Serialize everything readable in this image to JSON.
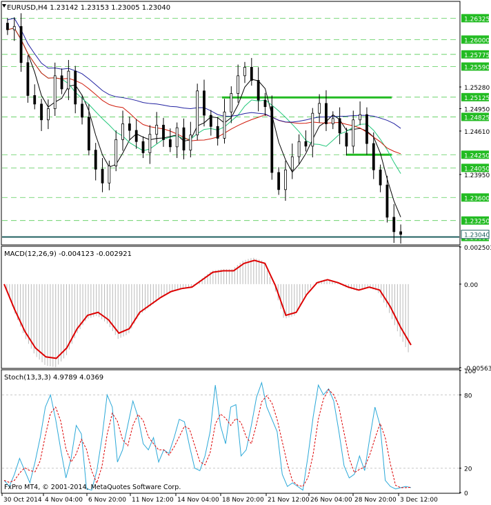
{
  "colors": {
    "background": "#ffffff",
    "frame": "#000000",
    "grid": "#c8c8c8",
    "hline": "#22bb22",
    "hline_dashed": "#55cc55",
    "price_tag_bg": "#1f5f5f",
    "ma_fast": "#000000",
    "ma_mid": "#21c77a",
    "ma_slow_red": "#d01a0a",
    "ma_slow_blue": "#2020a0",
    "macd_signal": "#dd0000",
    "macd_hist": "#b8b8b8",
    "stoch_main": "#2aa8d8",
    "stoch_signal": "#dd0000"
  },
  "main_panel": {
    "header": "EURUSD,H4  1.23142 1.23153 1.23005 1.23040",
    "current_price_label": "1.23040",
    "price_labels": [
      "1.26325",
      "1.26000",
      "1.25775",
      "1.25590",
      "1.25280",
      "1.25125",
      "1.24950",
      "1.24825",
      "1.24610",
      "1.24250",
      "1.24050",
      "1.23950",
      "1.23600",
      "1.23250",
      "1.23000"
    ],
    "price_label_style": [
      "box",
      "box",
      "box",
      "box",
      "plain",
      "box",
      "plain",
      "box",
      "plain",
      "box",
      "box",
      "plain",
      "box",
      "box",
      "box"
    ]
  },
  "macd_panel": {
    "header": "MACD(12,26,9) -0.004123 -0.002921",
    "labels": [
      "0.002503",
      "0.00",
      "-0.005631"
    ]
  },
  "stoch_panel": {
    "header": "Stoch(13,3,3) 4.9789 4.0369",
    "labels": [
      "100",
      "80",
      "20",
      "0"
    ]
  },
  "footer": {
    "copyright": "FxPro MT4, © 2001-2014, MetaQuotes Software Corp."
  },
  "x_axis_labels": [
    "30 Oct 2014",
    "4 Nov 04:00",
    "6 Nov 20:00",
    "11 Nov 12:00",
    "14 Nov 04:00",
    "18 Nov 20:00",
    "21 Nov 12:00",
    "26 Nov 04:00",
    "28 Nov 20:00",
    "3 Dec 12:00"
  ],
  "chart_data": [
    {
      "type": "candlestick",
      "symbol": "EURUSD",
      "timeframe": "H4",
      "title": "EURUSD,H4",
      "ohlc_last": {
        "open": 1.23142,
        "high": 1.23153,
        "low": 1.23005,
        "close": 1.2304
      },
      "x_labels": [
        "30 Oct 2014",
        "4 Nov 04:00",
        "6 Nov 20:00",
        "11 Nov 12:00",
        "14 Nov 04:00",
        "18 Nov 20:00",
        "21 Nov 12:00",
        "26 Nov 04:00",
        "28 Nov 20:00",
        "3 Dec 12:00"
      ],
      "ylim": [
        1.2289,
        1.2657
      ],
      "price_levels": [
        1.26325,
        1.26,
        1.25775,
        1.2559,
        1.2528,
        1.25125,
        1.2495,
        1.24825,
        1.2461,
        1.2425,
        1.2405,
        1.2395,
        1.236,
        1.2325,
        1.23
      ],
      "horizontal_lines": [
        {
          "price": 1.2512,
          "x_from": "18 Nov 20:00",
          "x_to": "28 Nov 20:00"
        },
        {
          "price": 1.2425,
          "x_from": "26 Nov 04:00",
          "x_to": "28 Nov 20:00"
        },
        {
          "price": 1.23,
          "x_from": "30 Oct 2014",
          "x_to": "3 Dec 12:00"
        }
      ],
      "close_path": [
        1.2615,
        1.262,
        1.2565,
        1.2515,
        1.2502,
        1.2478,
        1.2495,
        1.2545,
        1.2525,
        1.2552,
        1.2502,
        1.2482,
        1.2432,
        1.2403,
        1.2382,
        1.2408,
        1.2448,
        1.2472,
        1.2462,
        1.2445,
        1.2428,
        1.2456,
        1.247,
        1.2448,
        1.2437,
        1.2466,
        1.2432,
        1.2455,
        1.2522,
        1.2485,
        1.2468,
        1.245,
        1.249,
        1.2518,
        1.2545,
        1.2558,
        1.2538,
        1.2508,
        1.2498,
        1.2398,
        1.2372,
        1.2402,
        1.2422,
        1.2445,
        1.2438,
        1.2488,
        1.2503,
        1.2472,
        1.248,
        1.2458,
        1.2438,
        1.2478,
        1.2486,
        1.2442,
        1.2402,
        1.2379,
        1.233,
        1.2308,
        1.2304
      ]
    },
    {
      "type": "line",
      "title": "MACD(12,26,9) -0.004123 -0.002921",
      "ylim": [
        -0.005631,
        0.002503
      ],
      "x_labels": [
        "30 Oct 2014",
        "4 Nov 04:00",
        "6 Nov 20:00",
        "11 Nov 12:00",
        "14 Nov 04:00",
        "18 Nov 20:00",
        "21 Nov 12:00",
        "26 Nov 04:00",
        "28 Nov 20:00",
        "3 Dec 12:00"
      ],
      "series": [
        {
          "name": "main",
          "values": [
            0.0,
            -0.0017,
            -0.0032,
            -0.0043,
            -0.0049,
            -0.005,
            -0.0043,
            -0.003,
            -0.0021,
            -0.0019,
            -0.0024,
            -0.0033,
            -0.003,
            -0.0019,
            -0.0014,
            -0.0009,
            -0.0005,
            -0.0003,
            -0.0002,
            0.0003,
            0.0008,
            0.0009,
            0.0009,
            0.0014,
            0.0016,
            0.0014,
            -0.0001,
            -0.0021,
            -0.0019,
            -0.0007,
            0.0001,
            0.0003,
            0.0001,
            -0.0002,
            -0.0004,
            -0.0002,
            -0.0004,
            -0.0015,
            -0.0029,
            -0.0041
          ]
        },
        {
          "name": "signal",
          "values": [
            0.0,
            -0.0017,
            -0.0032,
            -0.0043,
            -0.0049,
            -0.005,
            -0.0043,
            -0.003,
            -0.0021,
            -0.0019,
            -0.0024,
            -0.0033,
            -0.003,
            -0.0019,
            -0.0014,
            -0.0009,
            -0.0005,
            -0.0003,
            -0.0002,
            0.0003,
            0.0008,
            0.0009,
            0.0009,
            0.0014,
            0.0016,
            0.0014,
            -0.0001,
            -0.0021,
            -0.0019,
            -0.0007,
            0.0001,
            0.0003,
            0.0001,
            -0.0002,
            -0.0004,
            -0.0002,
            -0.0004,
            -0.0015,
            -0.0029,
            -0.0041
          ]
        }
      ]
    },
    {
      "type": "line",
      "title": "Stoch(13,3,3) 4.9789 4.0369",
      "ylim": [
        0,
        100
      ],
      "levels": [
        20,
        80
      ],
      "x_labels": [
        "30 Oct 2014",
        "4 Nov 04:00",
        "6 Nov 20:00",
        "11 Nov 12:00",
        "14 Nov 04:00",
        "18 Nov 20:00",
        "21 Nov 12:00",
        "26 Nov 04:00",
        "28 Nov 20:00",
        "3 Dec 12:00"
      ],
      "series": [
        {
          "name": "main",
          "values": [
            10,
            5,
            15,
            28,
            18,
            8,
            25,
            45,
            70,
            80,
            60,
            35,
            12,
            28,
            55,
            48,
            3,
            2,
            18,
            45,
            80,
            70,
            25,
            35,
            55,
            75,
            62,
            40,
            35,
            45,
            25,
            35,
            32,
            45,
            60,
            58,
            38,
            20,
            18,
            30,
            50,
            88,
            55,
            40,
            70,
            72,
            30,
            35,
            55,
            78,
            90,
            70,
            60,
            50,
            15,
            5,
            8,
            5,
            2,
            30,
            62,
            88,
            80,
            85,
            75,
            50,
            22,
            12,
            15,
            30,
            18,
            45,
            70,
            55,
            10,
            5,
            3,
            4,
            5,
            4
          ]
        },
        {
          "name": "signal",
          "values": [
            10,
            5,
            15,
            28,
            18,
            8,
            25,
            45,
            70,
            80,
            60,
            35,
            12,
            28,
            55,
            48,
            3,
            2,
            18,
            45,
            80,
            70,
            25,
            35,
            55,
            75,
            62,
            40,
            35,
            45,
            25,
            35,
            32,
            45,
            60,
            58,
            38,
            20,
            18,
            30,
            50,
            88,
            55,
            40,
            70,
            72,
            30,
            35,
            55,
            78,
            90,
            70,
            60,
            50,
            15,
            5,
            8,
            5,
            2,
            30,
            62,
            88,
            80,
            85,
            75,
            50,
            22,
            12,
            15,
            30,
            18,
            45,
            70,
            55,
            10,
            5,
            3,
            4,
            5,
            4
          ]
        }
      ]
    }
  ]
}
